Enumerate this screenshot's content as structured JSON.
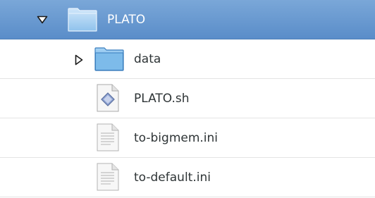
{
  "tree": {
    "root": {
      "label": "PLATO",
      "icon": "folder-icon",
      "expanded": true,
      "selected": true
    },
    "children": [
      {
        "label": "data",
        "icon": "folder-icon",
        "expanded": false
      },
      {
        "label": "PLATO.sh",
        "icon": "shell-script-icon"
      },
      {
        "label": "to-bigmem.ini",
        "icon": "text-file-icon"
      },
      {
        "label": "to-default.ini",
        "icon": "text-file-icon"
      }
    ]
  },
  "colors": {
    "selection": "#5a8dc9",
    "selection_text": "#ffffff",
    "text": "#2e3436",
    "folder": "#6fb3e8"
  }
}
